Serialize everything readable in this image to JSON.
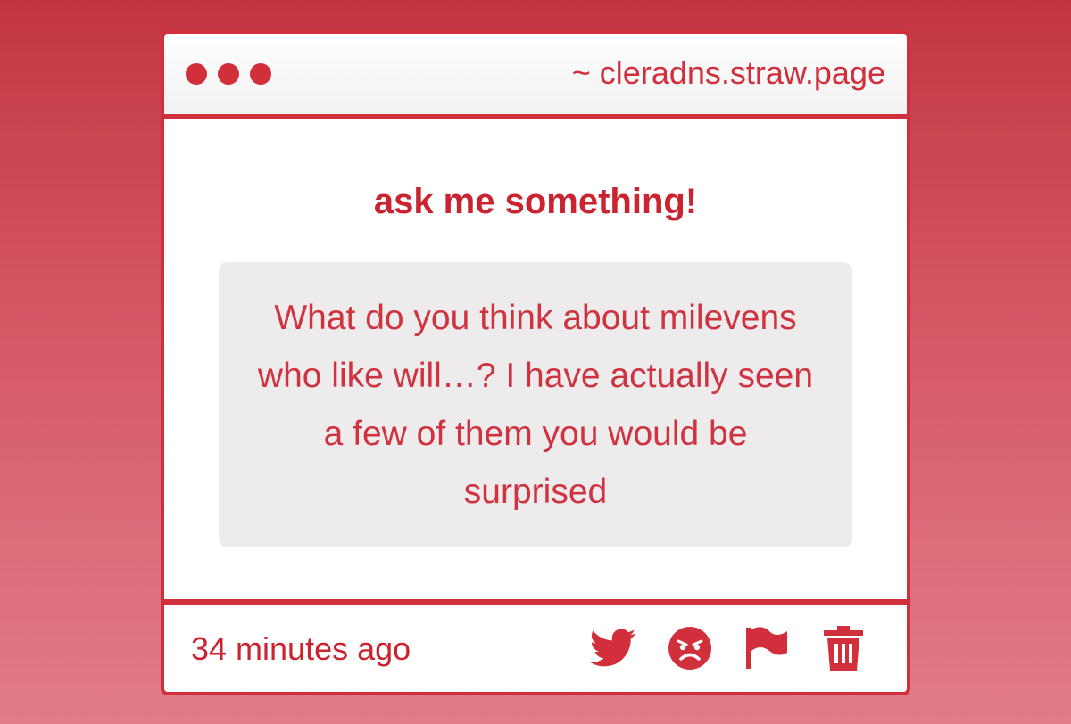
{
  "window": {
    "url": "~ cleradns.straw.page"
  },
  "main": {
    "heading": "ask me something!",
    "question": "What do you think about milevens who like will…? I have actually seen a few of them you would be surprised"
  },
  "footer": {
    "timestamp": "34 minutes ago",
    "actions": [
      {
        "icon": "twitter-icon"
      },
      {
        "icon": "angry-face-icon"
      },
      {
        "icon": "flag-icon"
      },
      {
        "icon": "trash-icon"
      }
    ]
  },
  "colors": {
    "accent": "#d12f3b",
    "question_bg": "#eeebec",
    "background_top": "#c23642",
    "background_bottom": "#e07c86"
  }
}
